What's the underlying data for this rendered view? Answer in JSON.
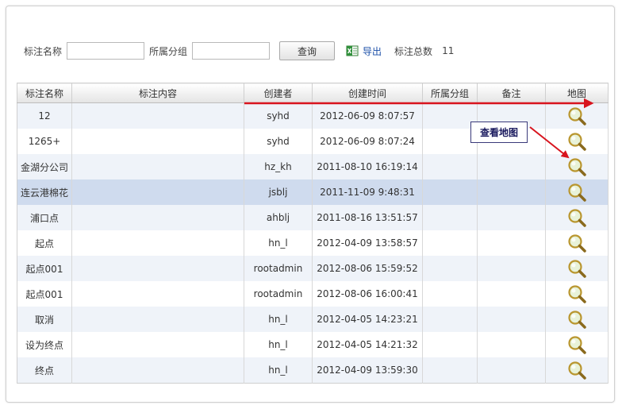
{
  "toolbar": {
    "name_label": "标注名称",
    "name_value": "",
    "group_label": "所属分组",
    "group_value": "",
    "query_label": "查询",
    "export_label": "导出",
    "total_label": "标注总数",
    "total_value": "11"
  },
  "table": {
    "columns": [
      "标注名称",
      "标注内容",
      "创建者",
      "创建时间",
      "所属分组",
      "备注",
      "地图"
    ],
    "rows": [
      {
        "name": "12",
        "content": "",
        "creator": "syhd",
        "time": "2012-06-09 8:07:57",
        "group": "",
        "note": ""
      },
      {
        "name": "1265+",
        "content": "",
        "creator": "syhd",
        "time": "2012-06-09 8:07:24",
        "group": "",
        "note": ""
      },
      {
        "name": "金湖分公司",
        "content": "",
        "creator": "hz_kh",
        "time": "2011-08-10 16:19:14",
        "group": "",
        "note": ""
      },
      {
        "name": "连云港棉花",
        "content": "",
        "creator": "jsblj",
        "time": "2011-11-09 9:48:31",
        "group": "",
        "note": ""
      },
      {
        "name": "浦口点",
        "content": "",
        "creator": "ahblj",
        "time": "2011-08-16 13:51:57",
        "group": "",
        "note": ""
      },
      {
        "name": "起点",
        "content": "",
        "creator": "hn_l",
        "time": "2012-04-09 13:58:57",
        "group": "",
        "note": ""
      },
      {
        "name": "起点001",
        "content": "",
        "creator": "rootadmin",
        "time": "2012-08-06 15:59:52",
        "group": "",
        "note": ""
      },
      {
        "name": "起点001",
        "content": "",
        "creator": "rootadmin",
        "time": "2012-08-06 16:00:41",
        "group": "",
        "note": ""
      },
      {
        "name": "取消",
        "content": "",
        "creator": "hn_l",
        "time": "2012-04-05 14:23:21",
        "group": "",
        "note": ""
      },
      {
        "name": "设为终点",
        "content": "",
        "creator": "hn_l",
        "time": "2012-04-05 14:21:32",
        "group": "",
        "note": ""
      },
      {
        "name": "终点",
        "content": "",
        "creator": "hn_l",
        "time": "2012-04-09 13:59:30",
        "group": "",
        "note": ""
      }
    ],
    "selected_index": 3,
    "map_icon": "magnifier-icon"
  },
  "annotation": {
    "callout_text": "查看地图",
    "arrow_color": "#d8141e"
  },
  "colors": {
    "row_alt": "#eff3f9",
    "row_selected": "#cfdbee",
    "link": "#1b4fa8"
  }
}
